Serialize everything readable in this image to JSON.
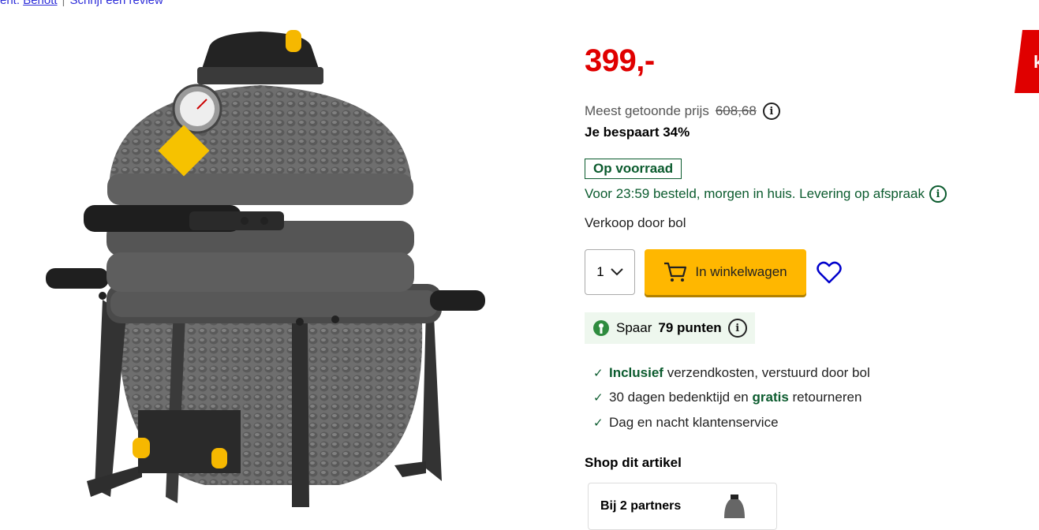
{
  "breadcrumb": {
    "prefix": "ent: ",
    "brand_link": "Berlott",
    "reviews": "Schrijf een review",
    "sep": "|"
  },
  "product": {
    "image_alt": "Kamado barbecue grijs"
  },
  "price": {
    "amount": "399,",
    "suffix": "-",
    "reference_label": "Meest getoonde prijs",
    "reference_value": "608,68",
    "savings": "Je bespaart 34%"
  },
  "stock": {
    "badge": "Op voorraad",
    "delivery": "Voor 23:59 besteld, morgen in huis. Levering op afspraak"
  },
  "seller": "Verkoop door bol",
  "cart": {
    "quantity": "1",
    "button_label": "In winkelwagen"
  },
  "points": {
    "label": "Spaar",
    "value": "79 punten"
  },
  "usps": [
    {
      "bold": "Inclusief",
      "rest": " verzendkosten, verstuurd door bol"
    },
    {
      "pre": "30 dagen bedenktijd en ",
      "bold": "gratis",
      "rest": " retourneren"
    },
    {
      "text": "Dag en nacht klantenservice"
    }
  ],
  "shop": {
    "title": "Shop dit artikel",
    "partner_label": "Bij 2 partners"
  },
  "colors": {
    "price": "#e00000",
    "accent_green": "#0b5b2e",
    "cart_button": "#ffb700",
    "wishlist": "#0000cc"
  }
}
